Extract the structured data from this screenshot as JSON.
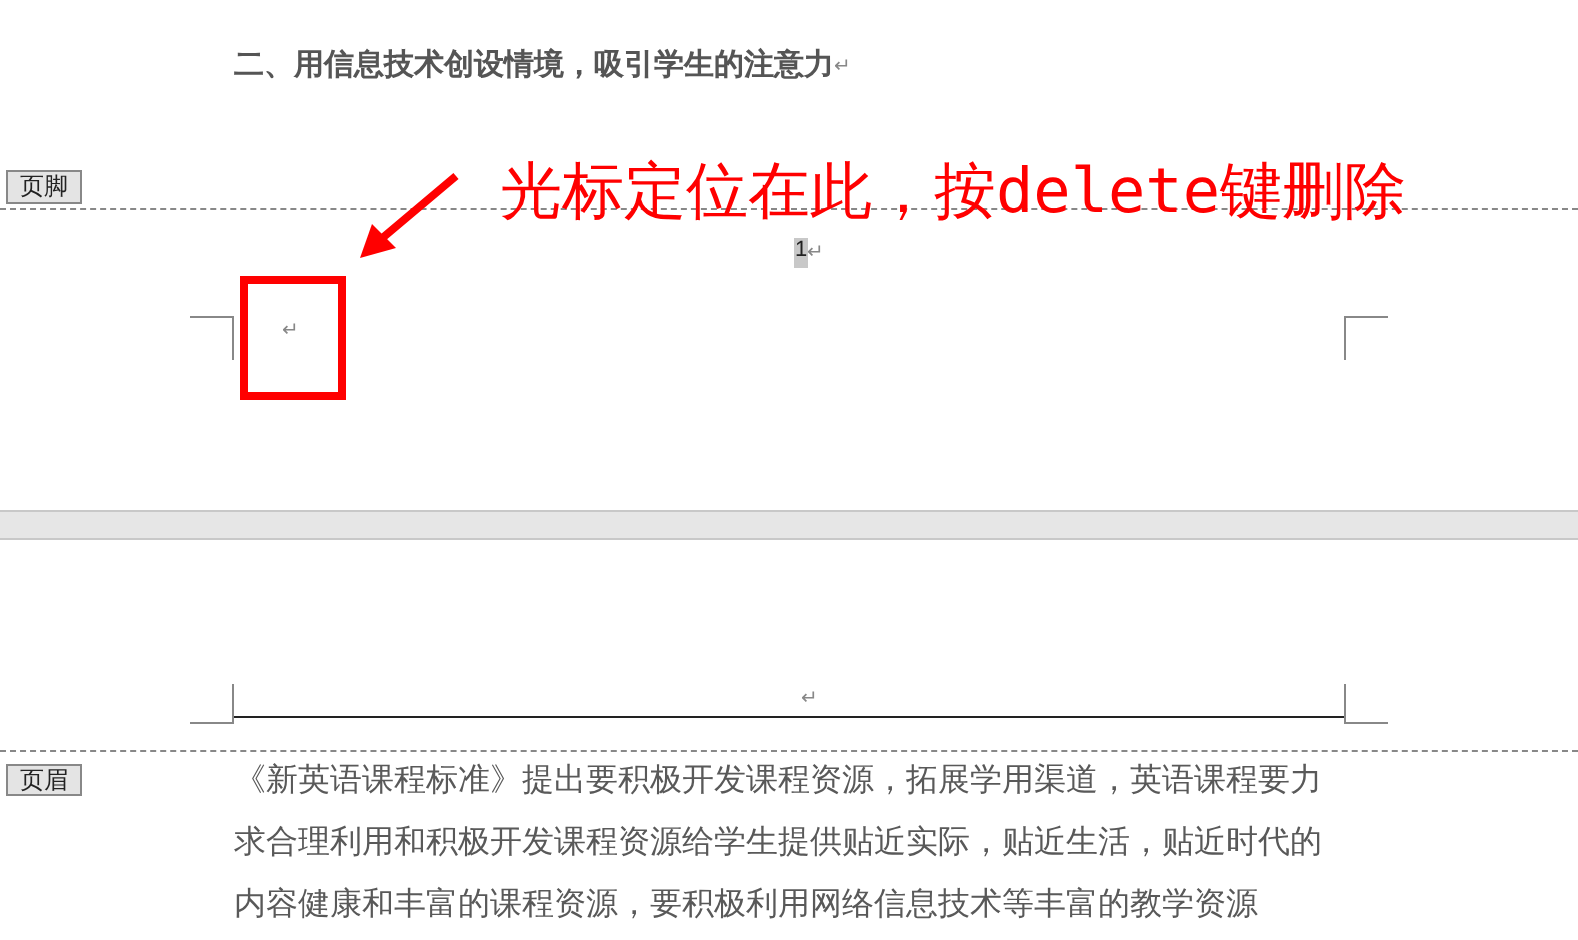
{
  "page1": {
    "heading": "二、用信息技术创设情境，吸引学生的注意力",
    "heading_mark": "↵",
    "footer_tag": "页脚",
    "footer_empty_mark": "↵",
    "page_number": "1",
    "page_number_mark": "↵"
  },
  "annotation": {
    "text": "光标定位在此，按delete键删除"
  },
  "page2": {
    "header_mark": "↵",
    "header_tag": "页眉",
    "lines": [
      "《新英语课程标准》提出要积极开发课程资源，拓展学用渠道，英语课程要力",
      "求合理利用和积极开发课程资源给学生提供贴近实际，贴近生活，贴近时代的",
      "内容健康和丰富的课程资源，要积极利用网络信息技术等丰富的教学资源"
    ]
  }
}
